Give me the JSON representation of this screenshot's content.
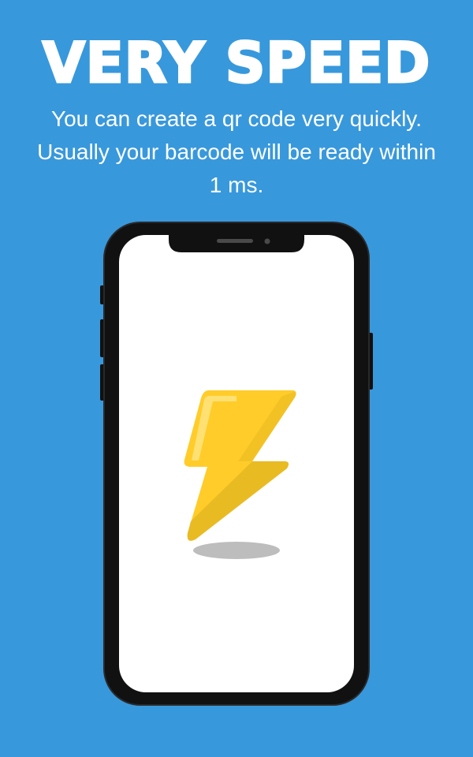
{
  "headline": "VERY SPEED",
  "subtitle": {
    "line1": "You can create a qr code very quickly.",
    "line2": "Usually your barcode will be ready within",
    "line3": "1 ms."
  },
  "colors": {
    "background": "#3898DC",
    "text": "#FFFFFF",
    "phone_frame": "#111111",
    "screen": "#FFFFFF",
    "bolt": "#FFCC29",
    "bolt_shade": "#E2B521",
    "bolt_highlight": "#FFE27A",
    "shadow": "#BDBDBD"
  },
  "icons": {
    "phone": "smartphone-illustration",
    "bolt": "lightning-bolt-icon"
  }
}
